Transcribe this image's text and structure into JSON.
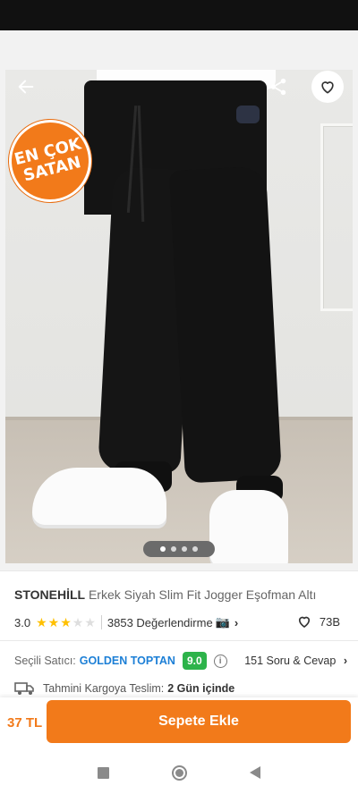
{
  "product": {
    "badge": {
      "line1": "EN ÇOK",
      "line2": "SATAN"
    },
    "image_count": 4,
    "active_image_index": 1
  },
  "title": {
    "brand": "STONEHİLL",
    "name": "Erkek Siyah Slim Fit Jogger Eşofman Altı"
  },
  "rating": {
    "score": "3.0",
    "stars_filled": 3,
    "stars_total": 5,
    "reviews_label": "3853 Değerlendirme",
    "camera_icon": "📷",
    "chevron": "›",
    "likes": "73B"
  },
  "seller": {
    "label": "Seçili Satıcı:",
    "name": "GOLDEN TOPTAN",
    "score": "9.0",
    "info_icon": "i",
    "qa_label": "151 Soru & Cevap",
    "qa_chevron": "›"
  },
  "shipping": {
    "label": "Tahmini Kargoya Teslim:",
    "value": "2 Gün içinde"
  },
  "purchase": {
    "price": "37 TL",
    "button_label": "Sepete Ekle"
  },
  "colors": {
    "accent": "#f27a1a",
    "seller_link": "#1c7fd6",
    "seller_score_bg": "#2db34a",
    "star": "#ffc000"
  },
  "icons": {
    "back": "arrow-left-icon",
    "share": "share-icon",
    "favorite": "heart-icon",
    "truck": "truck-icon"
  }
}
